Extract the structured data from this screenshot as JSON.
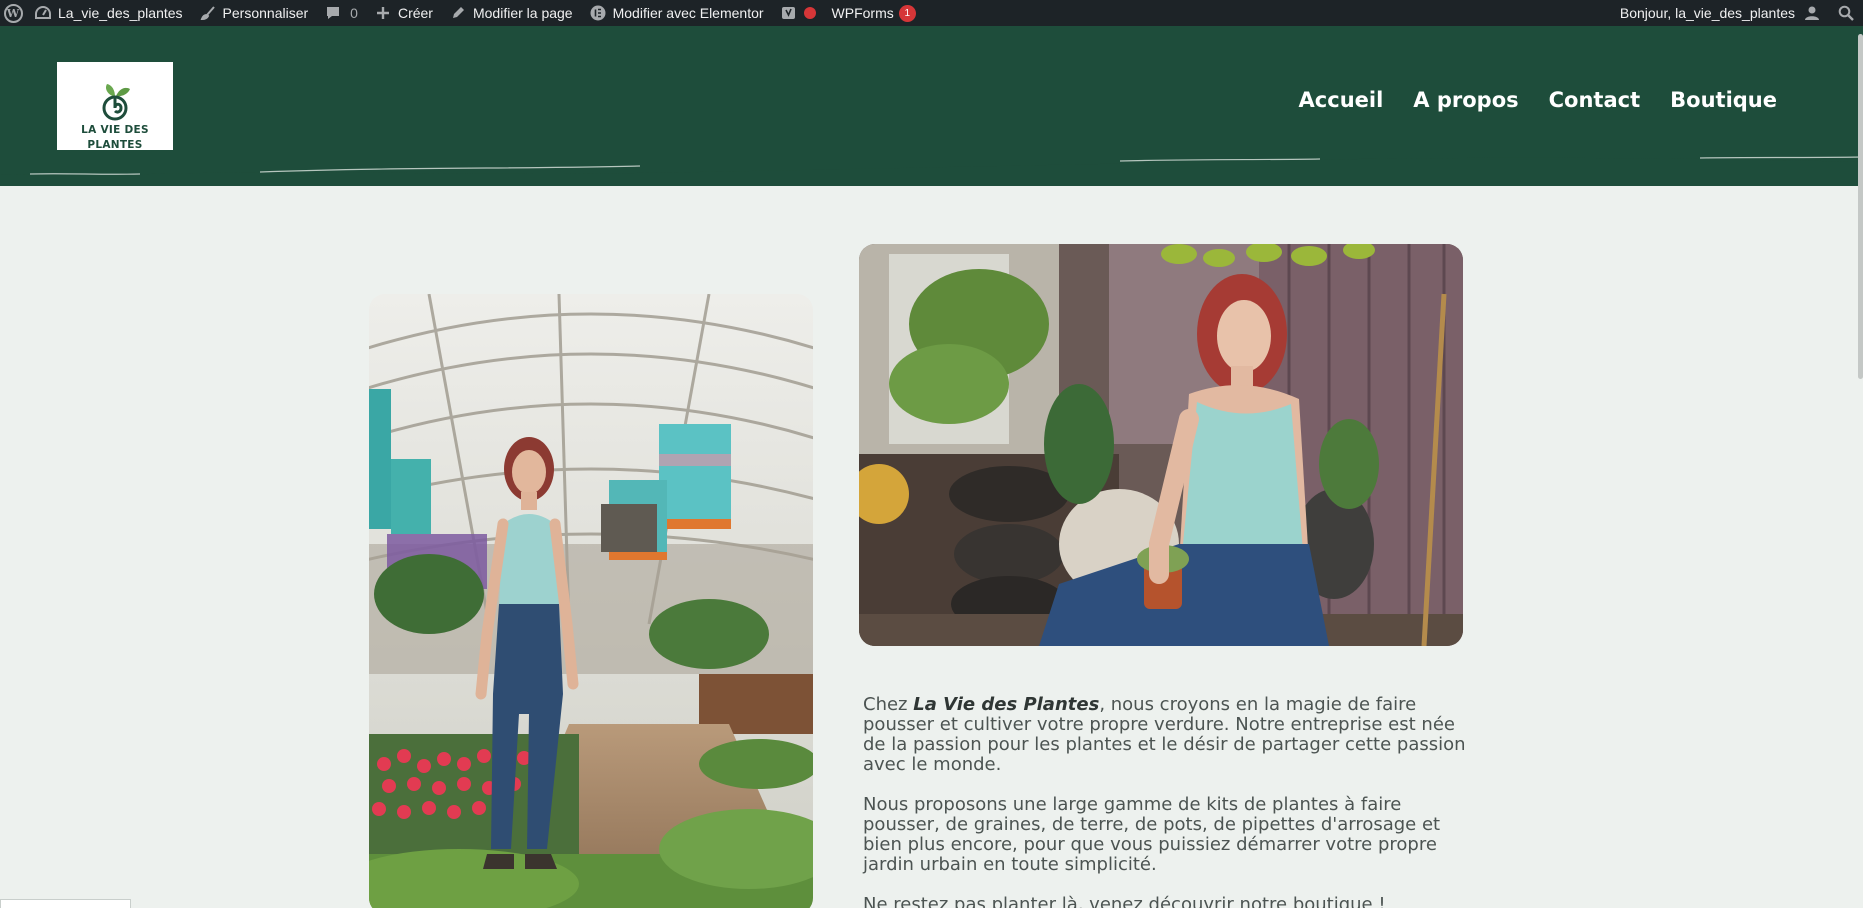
{
  "adminbar": {
    "site_name": "La_vie_des_plantes",
    "customize": "Personnaliser",
    "comments_count": "0",
    "create": "Créer",
    "edit_page": "Modifier la page",
    "edit_elementor": "Modifier avec Elementor",
    "wpforms": "WPForms",
    "wpforms_badge": "1",
    "greeting": "Bonjour, la_vie_des_plantes"
  },
  "header": {
    "logo_line1": "LA VIE DES",
    "logo_line2": "PLANTES",
    "brand_color": "#1e4d3b",
    "nav": [
      "Accueil",
      "A propos",
      "Contact",
      "Boutique"
    ]
  },
  "about": {
    "p1_prefix": "Chez ",
    "p1_brand": "La Vie des Plantes",
    "p1_rest": ", nous croyons en la magie de faire pousser et cultiver votre propre verdure. Notre entreprise est née de la passion pour les plantes et le désir de partager cette passion avec le monde.",
    "p2": "Nous proposons une large gamme de kits de plantes à faire pousser, de graines, de terre, de pots, de pipettes d'arrosage et bien plus encore, pour que vous puissiez démarrer votre propre jardin urbain en toute simplicité.",
    "p3": "Ne restez pas planter là, venez découvrir notre boutique !"
  },
  "icons": [
    "wordpress-icon",
    "customize-brush-icon",
    "comment-icon",
    "plus-icon",
    "pencil-icon",
    "elementor-icon",
    "yoast-icon",
    "status-dot-icon",
    "user-icon",
    "search-icon"
  ]
}
